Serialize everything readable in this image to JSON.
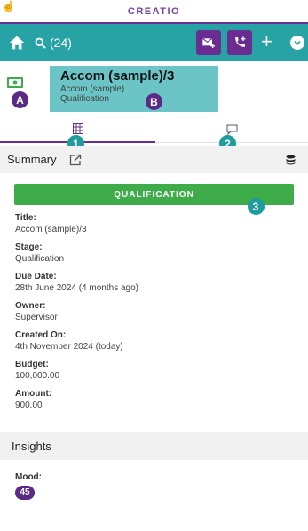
{
  "app": {
    "brand": "CREATIO"
  },
  "toolbar": {
    "search_count": "(24)"
  },
  "record": {
    "title": "Accom (sample)/3",
    "subtitle": "Accom (sample)",
    "stage": "Qualification"
  },
  "badges": {
    "a": "A",
    "b": "B",
    "one": "1",
    "two": "2",
    "three": "3"
  },
  "summary": {
    "title": "Summary"
  },
  "stage_button": {
    "label": "QUALIFICATION"
  },
  "fields": [
    {
      "label": "Title:",
      "value": "Accom (sample)/3"
    },
    {
      "label": "Stage:",
      "value": "Qualification"
    },
    {
      "label": "Due Date:",
      "value": "28th June 2024 (4 months ago)"
    },
    {
      "label": "Owner:",
      "value": "Supervisor"
    },
    {
      "label": "Created On:",
      "value": "4th November 2024 (today)"
    },
    {
      "label": "Budget:",
      "value": "100,000.00"
    },
    {
      "label": "Amount:",
      "value": "900.00"
    }
  ],
  "insights": {
    "title": "Insights",
    "mood_label": "Mood:",
    "mood_value": "45"
  },
  "colors": {
    "brand": "#6b2c91",
    "teal": "#27a3a5",
    "green": "#3fac4a"
  }
}
